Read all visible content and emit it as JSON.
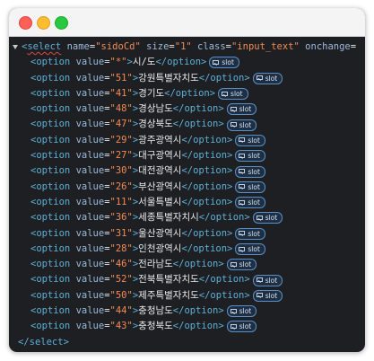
{
  "open_tag": {
    "open": "<",
    "name": "select",
    "attr1_name": "name",
    "eq1": "=",
    "attr1_value": "\"sidoCd\"",
    "attr2_name": "size",
    "eq2": "=",
    "attr2_value": "\"1\"",
    "attr3_name": "class",
    "eq3": "=",
    "attr3_value": "\"input_text\"",
    "attr4_name": "onchange",
    "attr4_rest": "="
  },
  "option_tag": {
    "open": "<option",
    "attr": "value",
    "eq": "=",
    "gt": ">",
    "close": "</option>"
  },
  "slot_label": "slot",
  "options": [
    {
      "value": "\"*\"",
      "text": "시/도"
    },
    {
      "value": "\"51\"",
      "text": "강원특별자치도"
    },
    {
      "value": "\"41\"",
      "text": "경기도"
    },
    {
      "value": "\"48\"",
      "text": "경상남도"
    },
    {
      "value": "\"47\"",
      "text": "경상북도"
    },
    {
      "value": "\"29\"",
      "text": "광주광역시"
    },
    {
      "value": "\"27\"",
      "text": "대구광역시"
    },
    {
      "value": "\"30\"",
      "text": "대전광역시"
    },
    {
      "value": "\"26\"",
      "text": "부산광역시"
    },
    {
      "value": "\"11\"",
      "text": "서울특별시"
    },
    {
      "value": "\"36\"",
      "text": "세종특별자치시"
    },
    {
      "value": "\"31\"",
      "text": "울산광역시"
    },
    {
      "value": "\"28\"",
      "text": "인천광역시"
    },
    {
      "value": "\"46\"",
      "text": "전라남도"
    },
    {
      "value": "\"52\"",
      "text": "전북특별자치도"
    },
    {
      "value": "\"50\"",
      "text": "제주특별자치도"
    },
    {
      "value": "\"44\"",
      "text": "충청남도"
    },
    {
      "value": "\"43\"",
      "text": "충청북도"
    }
  ],
  "close_tag": "</select>",
  "colors": {
    "tag": "#5db0d7",
    "attribute": "#9bbbdc",
    "attribute_value": "#f28b54",
    "background": "#1e1f22"
  }
}
